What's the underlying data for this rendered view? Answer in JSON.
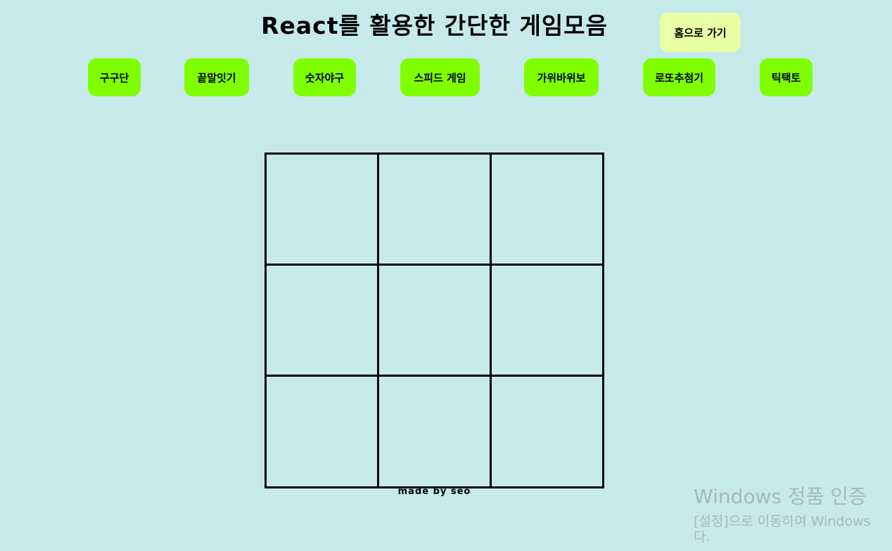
{
  "header": {
    "title": "React를 활용한 간단한 게임모음",
    "home_label": "홈으로 가기"
  },
  "nav": {
    "items": [
      {
        "label": "구구단"
      },
      {
        "label": "끝말잇기"
      },
      {
        "label": "숫자야구"
      },
      {
        "label": "스피드 게임"
      },
      {
        "label": "가위바위보"
      },
      {
        "label": "로또추첨기"
      },
      {
        "label": "틱택토"
      }
    ]
  },
  "board": {
    "rows": [
      [
        "",
        "",
        ""
      ],
      [
        "",
        "",
        ""
      ],
      [
        "",
        "",
        ""
      ]
    ]
  },
  "footer": {
    "text": "made by seo"
  },
  "watermark": {
    "title": "Windows 정품 인증",
    "line1": "[설정]으로 이동하여 Windows",
    "line2": "다."
  },
  "colors": {
    "background": "#c6eaea",
    "nav_button": "#7fff00",
    "home_button": "#e8ffa4"
  }
}
